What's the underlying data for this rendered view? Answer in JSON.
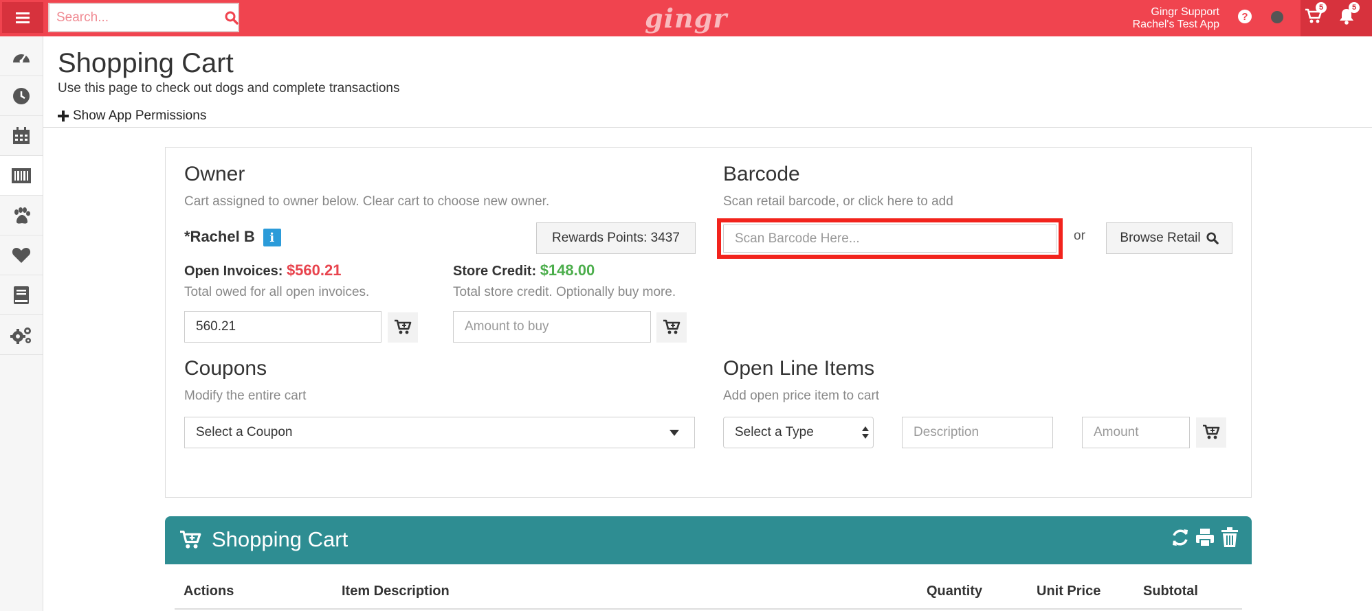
{
  "topbar": {
    "search_placeholder": "Search...",
    "logo": "gingr",
    "user_name": "Gingr Support",
    "app_name": "Rachel's Test App",
    "cart_count": "5",
    "notification_count": "5",
    "accent_color": "#f0444f"
  },
  "sidebar": {
    "items": [
      {
        "icon": "dashboard-icon"
      },
      {
        "icon": "clock-icon"
      },
      {
        "icon": "calendar-icon"
      },
      {
        "icon": "barcode-icon"
      },
      {
        "icon": "paw-icon"
      },
      {
        "icon": "heart-icon"
      },
      {
        "icon": "book-icon"
      },
      {
        "icon": "gears-icon"
      }
    ]
  },
  "page": {
    "title": "Shopping Cart",
    "subtitle": "Use this page to check out dogs and complete transactions",
    "permissions_link": "Show App Permissions"
  },
  "owner": {
    "heading": "Owner",
    "help": "Cart assigned to owner below. Clear cart to choose new owner.",
    "name": "*Rachel B",
    "info_glyph": "i",
    "rewards_label": "Rewards Points: 3437",
    "open_invoices_label": "Open Invoices:",
    "open_invoices_value": "$560.21",
    "open_invoices_help": "Total owed for all open invoices.",
    "invoice_amount": "560.21",
    "store_credit_label": "Store Credit:",
    "store_credit_value": "$148.00",
    "store_credit_help": "Total store credit. Optionally buy more.",
    "amount_to_buy_placeholder": "Amount to buy"
  },
  "barcode": {
    "heading": "Barcode",
    "help": "Scan retail barcode, or click here to add",
    "placeholder": "Scan Barcode Here...",
    "or_text": "or",
    "browse_retail_label": "Browse Retail",
    "highlight_color": "#f2231c"
  },
  "coupons": {
    "heading": "Coupons",
    "help": "Modify the entire cart",
    "select_placeholder": "Select a Coupon"
  },
  "open_line_items": {
    "heading": "Open Line Items",
    "help": "Add open price item to cart",
    "type_placeholder": "Select a Type",
    "description_placeholder": "Description",
    "amount_placeholder": "Amount"
  },
  "cart": {
    "title": "Shopping Cart",
    "color": "#2e8d92",
    "columns": [
      "Actions",
      "Item Description",
      "Quantity",
      "Unit Price",
      "Subtotal"
    ]
  }
}
